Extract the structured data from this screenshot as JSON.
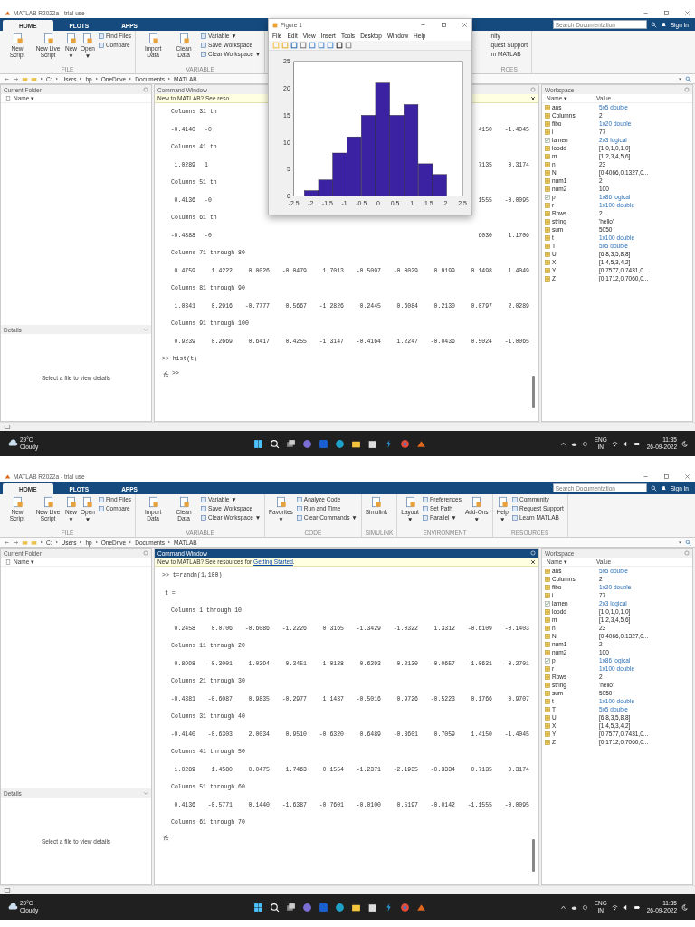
{
  "screens": [
    {
      "title": "MATLAB R2022a - trial use",
      "tabs": [
        {
          "label": "HOME",
          "selected": true
        },
        {
          "label": "PLOTS",
          "selected": false
        },
        {
          "label": "APPS",
          "selected": false
        }
      ],
      "search": {
        "placeholder": "Search Documentation"
      },
      "sign_in": "Sign In",
      "toolstrip": [
        {
          "label": "FILE",
          "items": [
            {
              "kind": "big",
              "label": "New Script"
            },
            {
              "kind": "big",
              "label": "New Live Script"
            },
            {
              "kind": "big",
              "label": "New",
              "caret": "▼"
            },
            {
              "kind": "big",
              "label": "Open",
              "caret": "▼"
            },
            {
              "kind": "small",
              "label": "Find Files"
            },
            {
              "kind": "small",
              "label": "Compare"
            }
          ]
        },
        {
          "label": "VARIABLE",
          "items": [
            {
              "kind": "big",
              "label": "Import Data"
            },
            {
              "kind": "big",
              "label": "Clean Data"
            },
            {
              "kind": "small",
              "label": "Variable ▼"
            },
            {
              "kind": "small",
              "label": "Save Workspace"
            },
            {
              "kind": "small",
              "label": "Clear Workspace ▼"
            }
          ]
        },
        {
          "label": "RCES",
          "kind": "cut",
          "items": [
            {
              "kind": "cut",
              "label": "nity"
            },
            {
              "kind": "cut",
              "label": "quest Support"
            },
            {
              "kind": "cut",
              "label": "rn MATLAB"
            }
          ]
        }
      ],
      "path": [
        "C:",
        "Users",
        "hp",
        "OneDrive",
        "Documents",
        "MATLAB"
      ],
      "current_folder": {
        "title": "Current Folder",
        "column": "Name ▾"
      },
      "details": {
        "title": "Details",
        "message": "Select a file to view details"
      },
      "command_window": {
        "title": "Command Window",
        "active": false,
        "banner": "New to MATLAB? See reso",
        "lines": [
          {
            "kind": "header",
            "text": "Columns 31 th"
          },
          {
            "kind": "values",
            "cells": [
              {
                "text": "-0.4140"
              },
              {
                "text": "-0",
                "cut": true
              },
              null,
              null,
              null,
              null,
              null,
              null,
              {
                "text": "4150"
              },
              {
                "text": "-1.4045"
              }
            ]
          },
          {
            "kind": "header",
            "text": "Columns 41 th"
          },
          {
            "kind": "values",
            "cells": [
              {
                "text": "1.0289"
              },
              {
                "text": "1",
                "cut": true
              },
              null,
              null,
              null,
              null,
              null,
              null,
              {
                "text": "7135"
              },
              {
                "text": "0.3174"
              }
            ]
          },
          {
            "kind": "header",
            "text": "Columns 51 th"
          },
          {
            "kind": "values",
            "cells": [
              {
                "text": "0.4136"
              },
              {
                "text": "-0",
                "cut": true
              },
              null,
              null,
              null,
              null,
              null,
              null,
              {
                "text": "1555"
              },
              {
                "text": "-0.0095"
              }
            ]
          },
          {
            "kind": "header",
            "text": "Columns 61 th"
          },
          {
            "kind": "values",
            "cells": [
              {
                "text": "-0.4888"
              },
              {
                "text": "-0",
                "cut": true
              },
              null,
              null,
              null,
              null,
              null,
              null,
              {
                "text": "6030"
              },
              {
                "text": "1.1706"
              }
            ]
          },
          {
            "kind": "header",
            "text": "Columns 71 through 80"
          },
          {
            "kind": "values",
            "cells": [
              {
                "text": "0.4759"
              },
              {
                "text": "1.4222"
              },
              {
                "text": "0.0026"
              },
              {
                "text": "-0.0479"
              },
              {
                "text": "1.7013"
              },
              {
                "text": "-0.5097"
              },
              {
                "text": "-0.0029"
              },
              {
                "text": "0.9199"
              },
              {
                "text": "0.1498"
              },
              {
                "text": "1.4049"
              }
            ]
          },
          {
            "kind": "header",
            "text": "Columns 81 through 90"
          },
          {
            "kind": "values",
            "cells": [
              {
                "text": "1.0341"
              },
              {
                "text": "0.2916"
              },
              {
                "text": "-0.7777"
              },
              {
                "text": "0.5667"
              },
              {
                "text": "-1.2826"
              },
              {
                "text": "0.2445"
              },
              {
                "text": "0.6084"
              },
              {
                "text": "0.2130"
              },
              {
                "text": "0.0797"
              },
              {
                "text": "2.0289"
              }
            ]
          },
          {
            "kind": "header",
            "text": "Columns 91 through 100"
          },
          {
            "kind": "values",
            "cells": [
              {
                "text": "0.9239"
              },
              {
                "text": "0.2669"
              },
              {
                "text": "0.6417"
              },
              {
                "text": "0.4255"
              },
              {
                "text": "-1.3147"
              },
              {
                "text": "-0.4164"
              },
              {
                "text": "1.2247"
              },
              {
                "text": "-0.0436"
              },
              {
                "text": "0.5024"
              },
              {
                "text": "-1.0065"
              }
            ]
          },
          {
            "kind": "input",
            "text": ">> hist(t)"
          },
          {
            "kind": "prompt",
            "text": ">>"
          }
        ]
      },
      "workspace": {
        "title": "Workspace",
        "columns": [
          "Name ▾",
          "Value"
        ],
        "variables": [
          {
            "name": "ans",
            "value": "5x5 double",
            "kind": "numeric",
            "summary": true
          },
          {
            "name": "Columns",
            "value": "2",
            "kind": "numeric",
            "summary": false
          },
          {
            "name": "fibo",
            "value": "1x20 double",
            "kind": "numeric",
            "summary": true
          },
          {
            "name": "i",
            "value": "77",
            "kind": "numeric",
            "summary": false
          },
          {
            "name": "lamen",
            "value": "2x3 logical",
            "kind": "logical",
            "summary": true
          },
          {
            "name": "loodd",
            "value": "[1,0,1,0,1,0]",
            "kind": "numeric",
            "summary": false
          },
          {
            "name": "m",
            "value": "[1,2,3,4,5,6]",
            "kind": "numeric",
            "summary": false
          },
          {
            "name": "n",
            "value": "23",
            "kind": "numeric",
            "summary": false
          },
          {
            "name": "N",
            "value": "[0.4066,0.1327,0...",
            "kind": "numeric",
            "summary": false
          },
          {
            "name": "num1",
            "value": "2",
            "kind": "numeric",
            "summary": false
          },
          {
            "name": "num2",
            "value": "100",
            "kind": "numeric",
            "summary": false
          },
          {
            "name": "p",
            "value": "1x86 logical",
            "kind": "logical",
            "summary": true
          },
          {
            "name": "r",
            "value": "1x100 double",
            "kind": "numeric",
            "summary": true
          },
          {
            "name": "Rows",
            "value": "2",
            "kind": "numeric",
            "summary": false
          },
          {
            "name": "string",
            "value": "'hello'",
            "kind": "numeric",
            "summary": false
          },
          {
            "name": "sum",
            "value": "5050",
            "kind": "numeric",
            "summary": false
          },
          {
            "name": "t",
            "value": "1x100 double",
            "kind": "numeric",
            "summary": true
          },
          {
            "name": "T",
            "value": "5x5 double",
            "kind": "numeric",
            "summary": true
          },
          {
            "name": "U",
            "value": "[6,8,3,5,8,8]",
            "kind": "numeric",
            "summary": false
          },
          {
            "name": "X",
            "value": "[1,4,5,3,4,2]",
            "kind": "numeric",
            "summary": false
          },
          {
            "name": "Y",
            "value": "[0.7577,0.7431,0...",
            "kind": "numeric",
            "summary": false
          },
          {
            "name": "Z",
            "value": "[0.1712,0.7060,0...",
            "kind": "numeric",
            "summary": false
          }
        ]
      },
      "figure": {
        "title": "Figure 1",
        "menus": [
          "File",
          "Edit",
          "View",
          "Insert",
          "Tools",
          "Desktop",
          "Window",
          "Help"
        ],
        "chart_data": {
          "type": "bar",
          "x": [
            -1.98,
            -1.56,
            -1.14,
            -0.72,
            -0.29,
            0.13,
            0.55,
            0.97,
            1.4,
            1.82
          ],
          "values": [
            1,
            3,
            8,
            11,
            15,
            21,
            15,
            17,
            6,
            4
          ],
          "xlim": [
            -2.5,
            2.5
          ],
          "ylim": [
            0,
            25
          ],
          "xticks": [
            -2.5,
            -2,
            -1.5,
            -1,
            -0.5,
            0,
            0.5,
            1,
            1.5,
            2,
            2.5
          ],
          "yticks": [
            0,
            5,
            10,
            15,
            20,
            25
          ]
        }
      },
      "taskbar": {
        "temperature": "29°C",
        "weather": "Cloudy",
        "language": "ENG",
        "region": "IN",
        "time": "11:35",
        "date": "26-09-2022"
      }
    },
    {
      "title": "MATLAB R2022a - trial use",
      "tabs": [
        {
          "label": "HOME",
          "selected": true
        },
        {
          "label": "PLOTS",
          "selected": false
        },
        {
          "label": "APPS",
          "selected": false
        }
      ],
      "search": {
        "placeholder": "Search Documentation"
      },
      "sign_in": "Sign In",
      "toolstrip": [
        {
          "label": "FILE",
          "items": [
            {
              "kind": "big",
              "label": "New Script"
            },
            {
              "kind": "big",
              "label": "New Live Script"
            },
            {
              "kind": "big",
              "label": "New",
              "caret": "▼"
            },
            {
              "kind": "big",
              "label": "Open",
              "caret": "▼"
            },
            {
              "kind": "small",
              "label": "Find Files"
            },
            {
              "kind": "small",
              "label": "Compare"
            }
          ]
        },
        {
          "label": "VARIABLE",
          "items": [
            {
              "kind": "big",
              "label": "Import Data"
            },
            {
              "kind": "big",
              "label": "Clean Data"
            },
            {
              "kind": "small",
              "label": "Variable ▼"
            },
            {
              "kind": "small",
              "label": "Save Workspace"
            },
            {
              "kind": "small",
              "label": "Clear Workspace ▼"
            }
          ]
        },
        {
          "label": "CODE",
          "items": [
            {
              "kind": "big",
              "label": "Favorites",
              "caret": "▼"
            },
            {
              "kind": "small",
              "label": "Analyze Code"
            },
            {
              "kind": "small",
              "label": "Run and Time"
            },
            {
              "kind": "small",
              "label": "Clear Commands ▼"
            }
          ]
        },
        {
          "label": "SIMULINK",
          "items": [
            {
              "kind": "big",
              "label": "Simulink"
            }
          ]
        },
        {
          "label": "ENVIRONMENT",
          "items": [
            {
              "kind": "big",
              "label": "Layout",
              "caret": "▼"
            },
            {
              "kind": "small",
              "label": "Preferences"
            },
            {
              "kind": "small",
              "label": "Set Path"
            },
            {
              "kind": "small",
              "label": "Parallel ▼"
            },
            {
              "kind": "big",
              "label": "Add-Ons",
              "caret": "▼"
            }
          ]
        },
        {
          "label": "RESOURCES",
          "items": [
            {
              "kind": "big",
              "label": "Help",
              "caret": "▼"
            },
            {
              "kind": "small",
              "label": "Community"
            },
            {
              "kind": "small",
              "label": "Request Support"
            },
            {
              "kind": "small",
              "label": "Learn MATLAB"
            }
          ]
        }
      ],
      "path": [
        "C:",
        "Users",
        "hp",
        "OneDrive",
        "Documents",
        "MATLAB"
      ],
      "current_folder": {
        "title": "Current Folder",
        "column": "Name ▾"
      },
      "details": {
        "title": "Details",
        "message": "Select a file to view details"
      },
      "command_window": {
        "title": "Command Window",
        "active": true,
        "banner": "New to MATLAB? See resources for ",
        "banner_link": "Getting Started",
        "banner_end": ".",
        "lines": [
          {
            "kind": "input",
            "text": ">> t=randn(1,100)"
          },
          {
            "kind": "text",
            "text": "t ="
          },
          {
            "kind": "header",
            "text": "Columns 1 through 10"
          },
          {
            "kind": "values",
            "cells": [
              {
                "text": "0.2458"
              },
              {
                "text": "0.0706"
              },
              {
                "text": "-0.6086"
              },
              {
                "text": "-1.2226"
              },
              {
                "text": "0.3165"
              },
              {
                "text": "-1.3429"
              },
              {
                "text": "-1.0322"
              },
              {
                "text": "1.3312"
              },
              {
                "text": "-0.6109"
              },
              {
                "text": "-0.1403"
              }
            ]
          },
          {
            "kind": "header",
            "text": "Columns 11 through 20"
          },
          {
            "kind": "values",
            "cells": [
              {
                "text": "0.8998"
              },
              {
                "text": "-0.3001"
              },
              {
                "text": "1.0294"
              },
              {
                "text": "-0.3451"
              },
              {
                "text": "1.0128"
              },
              {
                "text": "0.6293"
              },
              {
                "text": "-0.2130"
              },
              {
                "text": "-0.0657"
              },
              {
                "text": "-1.0631"
              },
              {
                "text": "-0.2701"
              }
            ]
          },
          {
            "kind": "header",
            "text": "Columns 21 through 30"
          },
          {
            "kind": "values",
            "cells": [
              {
                "text": "-0.4381"
              },
              {
                "text": "-0.6087"
              },
              {
                "text": "0.9835"
              },
              {
                "text": "-0.2977"
              },
              {
                "text": "1.1437"
              },
              {
                "text": "-0.5016"
              },
              {
                "text": "0.9726"
              },
              {
                "text": "-0.5223"
              },
              {
                "text": "0.1766"
              },
              {
                "text": "0.9707"
              }
            ]
          },
          {
            "kind": "header",
            "text": "Columns 31 through 40"
          },
          {
            "kind": "values",
            "cells": [
              {
                "text": "-0.4140"
              },
              {
                "text": "-0.6303"
              },
              {
                "text": "2.0034"
              },
              {
                "text": "0.9510"
              },
              {
                "text": "-0.6320"
              },
              {
                "text": "0.6489"
              },
              {
                "text": "-0.3601"
              },
              {
                "text": "0.7059"
              },
              {
                "text": "1.4150"
              },
              {
                "text": "-1.4045"
              }
            ]
          },
          {
            "kind": "header",
            "text": "Columns 41 through 50"
          },
          {
            "kind": "values",
            "cells": [
              {
                "text": "1.0289"
              },
              {
                "text": "1.4580"
              },
              {
                "text": "0.0475"
              },
              {
                "text": "1.7463"
              },
              {
                "text": "0.1554"
              },
              {
                "text": "-1.2371"
              },
              {
                "text": "-2.1935"
              },
              {
                "text": "-0.3334"
              },
              {
                "text": "0.7135"
              },
              {
                "text": "0.3174"
              }
            ]
          },
          {
            "kind": "header",
            "text": "Columns 51 through 60"
          },
          {
            "kind": "values",
            "cells": [
              {
                "text": "0.4136"
              },
              {
                "text": "-0.5771"
              },
              {
                "text": "0.1440"
              },
              {
                "text": "-1.6387"
              },
              {
                "text": "-0.7601"
              },
              {
                "text": "-0.0100"
              },
              {
                "text": "0.5197"
              },
              {
                "text": "-0.0142"
              },
              {
                "text": "-1.1555"
              },
              {
                "text": "-0.0095"
              }
            ]
          },
          {
            "kind": "header",
            "text": "Columns 61 through 70"
          },
          {
            "kind": "prompt"
          }
        ]
      },
      "workspace": {
        "title": "Workspace",
        "columns": [
          "Name ▾",
          "Value"
        ],
        "variables": [
          {
            "name": "ans",
            "value": "5x5 double",
            "kind": "numeric",
            "summary": true
          },
          {
            "name": "Columns",
            "value": "2",
            "kind": "numeric",
            "summary": false
          },
          {
            "name": "fibo",
            "value": "1x20 double",
            "kind": "numeric",
            "summary": true
          },
          {
            "name": "i",
            "value": "77",
            "kind": "numeric",
            "summary": false
          },
          {
            "name": "lamen",
            "value": "2x3 logical",
            "kind": "logical",
            "summary": true
          },
          {
            "name": "loodd",
            "value": "[1,0,1,0,1,0]",
            "kind": "numeric",
            "summary": false
          },
          {
            "name": "m",
            "value": "[1,2,3,4,5,6]",
            "kind": "numeric",
            "summary": false
          },
          {
            "name": "n",
            "value": "23",
            "kind": "numeric",
            "summary": false
          },
          {
            "name": "N",
            "value": "[0.4066,0.1327,0...",
            "kind": "numeric",
            "summary": false
          },
          {
            "name": "num1",
            "value": "2",
            "kind": "numeric",
            "summary": false
          },
          {
            "name": "num2",
            "value": "100",
            "kind": "numeric",
            "summary": false
          },
          {
            "name": "p",
            "value": "1x86 logical",
            "kind": "logical",
            "summary": true
          },
          {
            "name": "r",
            "value": "1x100 double",
            "kind": "numeric",
            "summary": true
          },
          {
            "name": "Rows",
            "value": "2",
            "kind": "numeric",
            "summary": false
          },
          {
            "name": "string",
            "value": "'hello'",
            "kind": "numeric",
            "summary": false
          },
          {
            "name": "sum",
            "value": "5050",
            "kind": "numeric",
            "summary": false
          },
          {
            "name": "t",
            "value": "1x100 double",
            "kind": "numeric",
            "summary": true
          },
          {
            "name": "T",
            "value": "5x5 double",
            "kind": "numeric",
            "summary": true
          },
          {
            "name": "U",
            "value": "[6,8,3,5,8,8]",
            "kind": "numeric",
            "summary": false
          },
          {
            "name": "X",
            "value": "[1,4,5,3,4,2]",
            "kind": "numeric",
            "summary": false
          },
          {
            "name": "Y",
            "value": "[0.7577,0.7431,0...",
            "kind": "numeric",
            "summary": false
          },
          {
            "name": "Z",
            "value": "[0.1712,0.7060,0...",
            "kind": "numeric",
            "summary": false
          }
        ]
      },
      "taskbar": {
        "temperature": "29°C",
        "weather": "Cloudy",
        "language": "ENG",
        "region": "IN",
        "time": "11:35",
        "date": "26-09-2022"
      }
    }
  ]
}
